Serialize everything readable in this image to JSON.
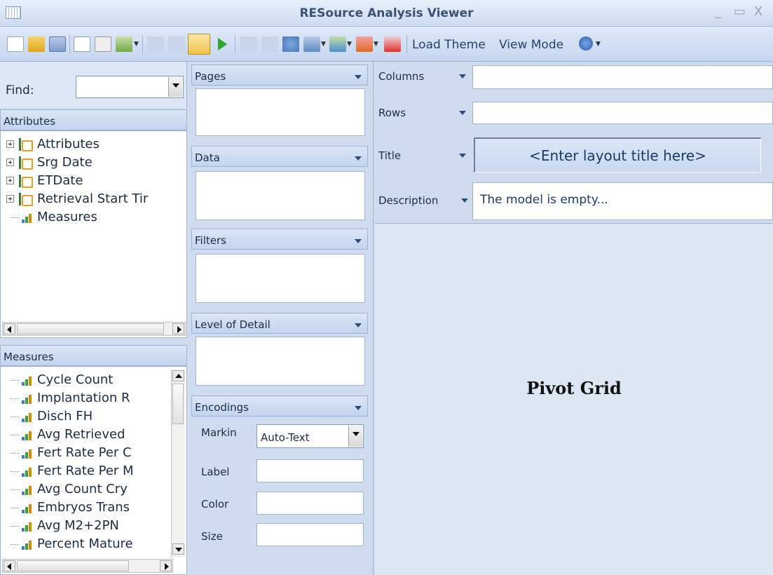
{
  "window": {
    "title": "RESource Analysis Viewer",
    "minimize": "_",
    "maximize": "▭",
    "close": "X"
  },
  "toolbar": {
    "load_theme": "Load Theme",
    "view_mode": "View Mode"
  },
  "find": {
    "label": "Find:"
  },
  "attributes": {
    "header": "Attributes",
    "items": [
      {
        "label": "Attributes",
        "type": "dimension"
      },
      {
        "label": "Srg Date",
        "type": "dimension"
      },
      {
        "label": "ETDate",
        "type": "dimension"
      },
      {
        "label": "Retrieval Start Tir",
        "type": "dimension"
      },
      {
        "label": "Measures",
        "type": "measure"
      }
    ]
  },
  "measures": {
    "header": "Measures",
    "items": [
      "Cycle Count",
      "Implantation R",
      "Disch FH",
      "Avg Retrieved",
      "Fert Rate Per C",
      "Fert Rate Per M",
      "Avg Count Cry",
      "Embryos Trans",
      "Avg M2+2PN",
      "Percent Mature"
    ]
  },
  "shelves": {
    "pages": "Pages",
    "data": "Data",
    "filters": "Filters",
    "level_of_detail": "Level of Detail",
    "encodings": "Encodings"
  },
  "encodings": {
    "marking_label": "Markin",
    "marking_value": "Auto-Text",
    "label": "Label",
    "color": "Color",
    "size": "Size"
  },
  "layout": {
    "columns": "Columns",
    "rows": "Rows",
    "title_label": "Title",
    "title_placeholder": "<Enter layout title here>",
    "description_label": "Description",
    "description_text": "The model is empty..."
  },
  "pivot": {
    "label": "Pivot Grid"
  }
}
